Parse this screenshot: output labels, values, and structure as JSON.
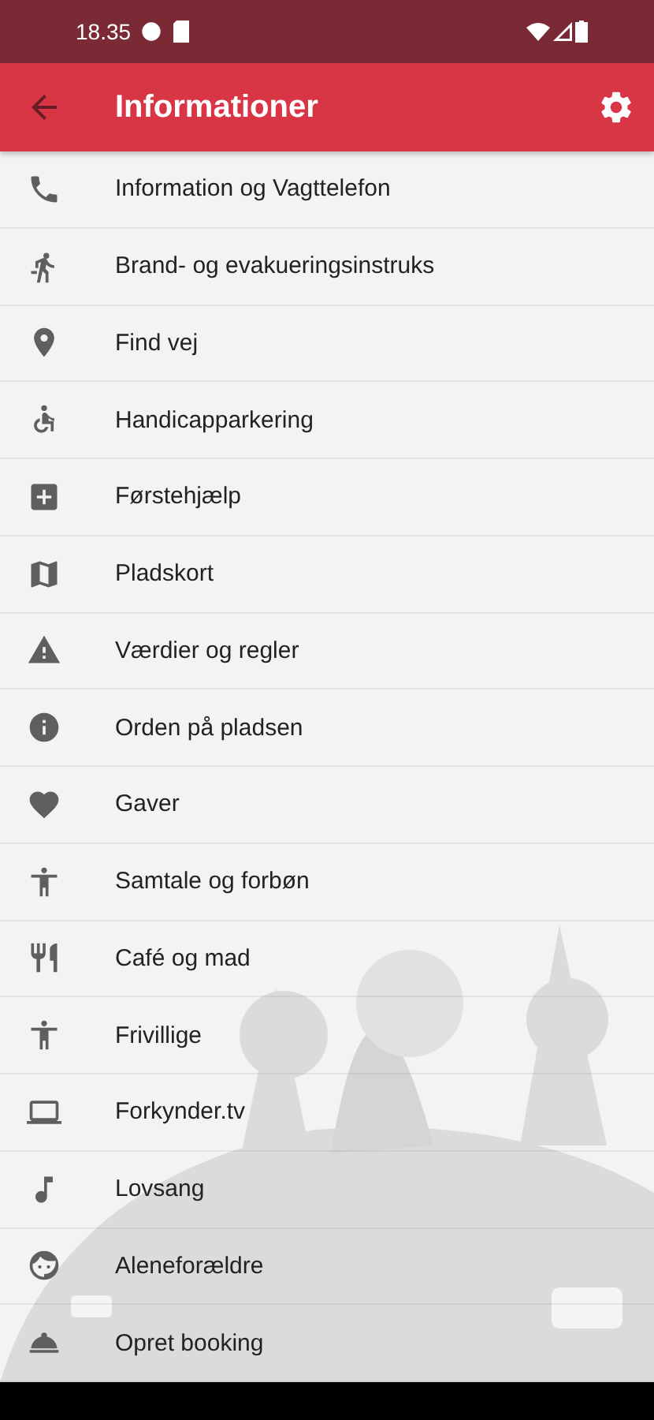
{
  "status_bar": {
    "time": "18.35"
  },
  "app_bar": {
    "title": "Informationer"
  },
  "items": [
    {
      "label": "Information og Vagttelefon"
    },
    {
      "label": "Brand- og evakueringsinstruks"
    },
    {
      "label": "Find vej"
    },
    {
      "label": "Handicapparkering"
    },
    {
      "label": "Førstehjælp"
    },
    {
      "label": "Pladskort"
    },
    {
      "label": "Værdier og regler"
    },
    {
      "label": "Orden på pladsen"
    },
    {
      "label": "Gaver"
    },
    {
      "label": "Samtale og forbøn"
    },
    {
      "label": "Café og mad"
    },
    {
      "label": "Frivillige"
    },
    {
      "label": "Forkynder.tv"
    },
    {
      "label": "Lovsang"
    },
    {
      "label": "Aleneforældre"
    },
    {
      "label": "Opret booking"
    }
  ]
}
